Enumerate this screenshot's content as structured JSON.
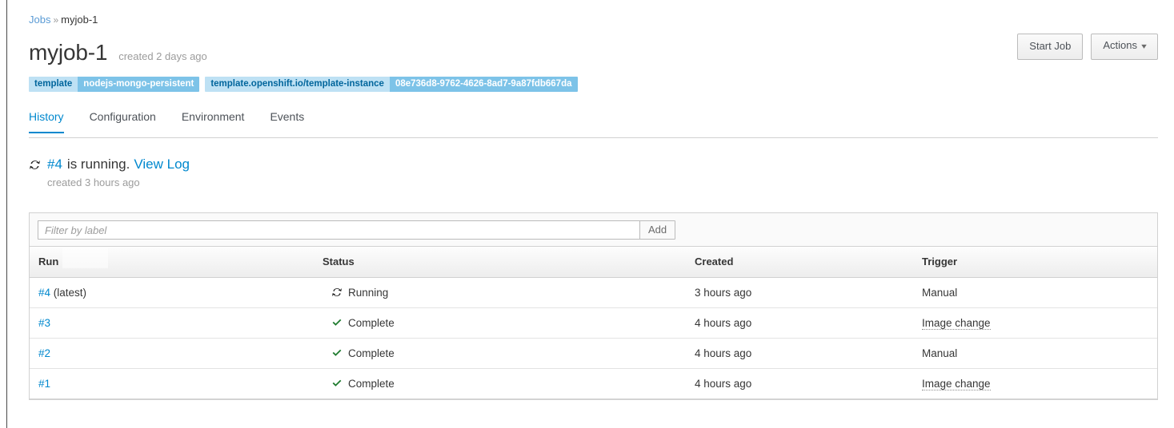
{
  "breadcrumb": {
    "root": "Jobs",
    "separator": "»",
    "current": "myjob-1"
  },
  "header": {
    "title": "myjob-1",
    "meta": "created 2 days ago",
    "start_job_label": "Start Job",
    "actions_label": "Actions",
    "actions_caret": "⌄"
  },
  "labels": [
    {
      "key": "template",
      "value": "nodejs-mongo-persistent"
    },
    {
      "key": "template.openshift.io/template-instance",
      "value": "08e736d8-9762-4626-8ad7-9a87fdb667da"
    }
  ],
  "tabs": [
    {
      "label": "History",
      "active": true
    },
    {
      "label": "Configuration",
      "active": false
    },
    {
      "label": "Environment",
      "active": false
    },
    {
      "label": "Events",
      "active": false
    }
  ],
  "status": {
    "icon": "sync-spinner-icon",
    "run": "#4",
    "text": "is running.",
    "link": "View Log",
    "sub": "created 3 hours ago"
  },
  "filter": {
    "placeholder": "Filter by label",
    "value": "",
    "add_label": "Add"
  },
  "table": {
    "columns": [
      "Run",
      "Status",
      "Created",
      "Trigger"
    ],
    "rows": [
      {
        "run": "#4",
        "run_note": " (latest)",
        "status_icon": "sync-spinner-icon",
        "status": "Running",
        "created": "3 hours ago",
        "trigger": "Manual",
        "trigger_tooltip": false
      },
      {
        "run": "#3",
        "run_note": "",
        "status_icon": "check-icon",
        "status": "Complete",
        "created": "4 hours ago",
        "trigger": "Image change",
        "trigger_tooltip": true
      },
      {
        "run": "#2",
        "run_note": "",
        "status_icon": "check-icon",
        "status": "Complete",
        "created": "4 hours ago",
        "trigger": "Manual",
        "trigger_tooltip": false
      },
      {
        "run": "#1",
        "run_note": "",
        "status_icon": "check-icon",
        "status": "Complete",
        "created": "4 hours ago",
        "trigger": "Image change",
        "trigger_tooltip": true
      }
    ]
  },
  "colors": {
    "link": "#0088ce",
    "breadcrumb_link": "#5a9bd5",
    "label_key_bg": "#bee1f4",
    "label_key_text": "#00659c",
    "label_value_bg": "#7dc3e8",
    "label_value_text": "#ffffff",
    "tab_active": "#0088ce",
    "success": "#1f7b2f",
    "muted_text": "#9c9c9c",
    "border": "#d1d1d1"
  }
}
